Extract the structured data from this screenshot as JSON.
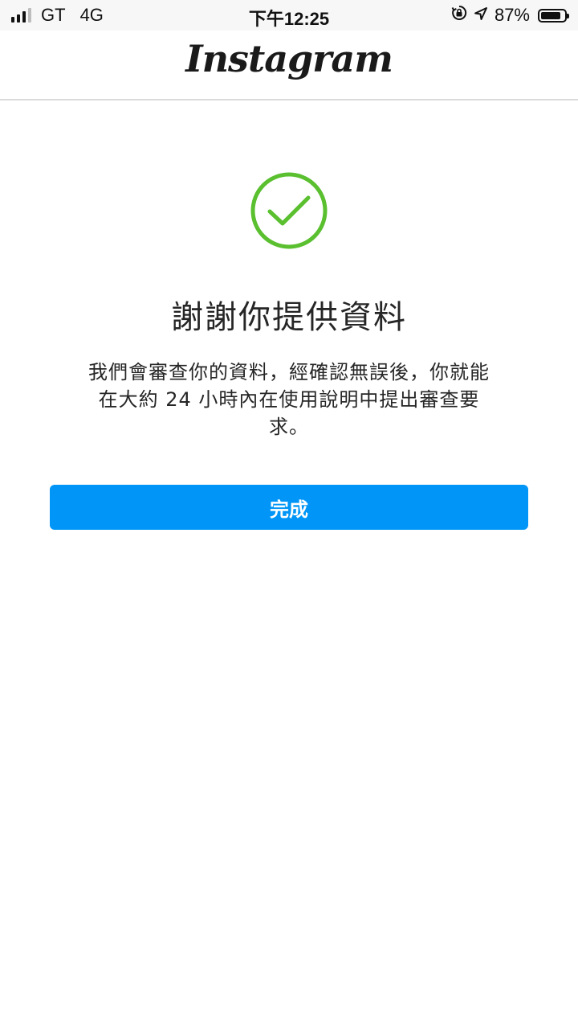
{
  "status_bar": {
    "carrier": "GT",
    "network": "4G",
    "time": "下午12:25",
    "battery_percent": "87%",
    "battery_level": 0.87,
    "signal_bars_active": 3,
    "icons": [
      "signal-icon",
      "orientation-lock-icon",
      "location-icon",
      "battery-icon"
    ]
  },
  "header": {
    "logo_text": "Instagram"
  },
  "main": {
    "success_icon": "check-circle-icon",
    "accent_color": "#5ac02f",
    "title": "謝謝你提供資料",
    "description_lines": [
      "我們會審查你的資料，經確認無誤後，你就能",
      "在大約 24 小時內在使用說明中提出審查要",
      "求。"
    ],
    "done_button_label": "完成",
    "button_color": "#0095f6"
  }
}
